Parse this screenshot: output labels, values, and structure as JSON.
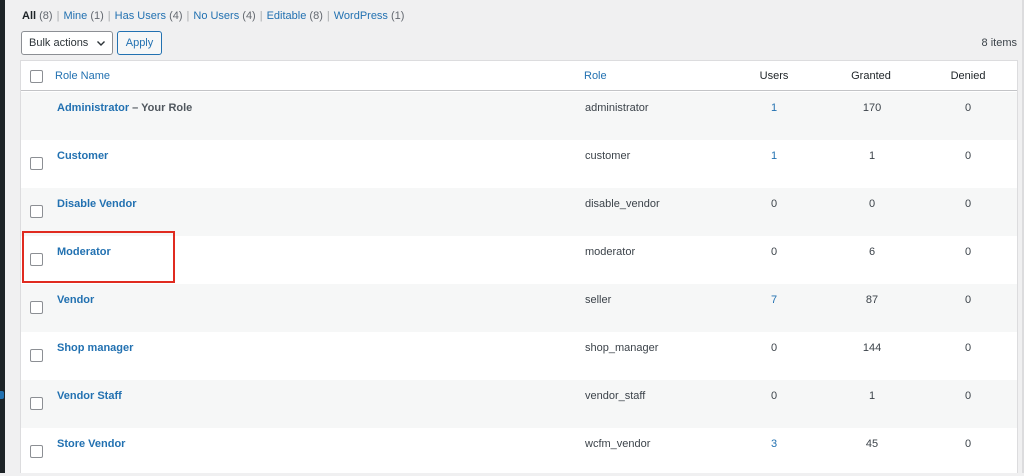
{
  "views": [
    {
      "label": "All",
      "count": "(8)",
      "current": true
    },
    {
      "label": "Mine",
      "count": "(1)",
      "current": false
    },
    {
      "label": "Has Users",
      "count": "(4)",
      "current": false
    },
    {
      "label": "No Users",
      "count": "(4)",
      "current": false
    },
    {
      "label": "Editable",
      "count": "(8)",
      "current": false
    },
    {
      "label": "WordPress",
      "count": "(1)",
      "current": false
    }
  ],
  "view_separator": "|",
  "bulk_actions": {
    "selected": "Bulk actions"
  },
  "apply_label": "Apply",
  "items_count": "8 items",
  "columns": {
    "role_name": "Role Name",
    "role": "Role",
    "users": "Users",
    "granted": "Granted",
    "denied": "Denied"
  },
  "rows": [
    {
      "name": "Administrator",
      "suffix": " – Your Role",
      "slug": "administrator",
      "users": "1",
      "granted": "170",
      "denied": "0",
      "checkbox": false
    },
    {
      "name": "Customer",
      "suffix": "",
      "slug": "customer",
      "users": "1",
      "granted": "1",
      "denied": "0",
      "checkbox": true
    },
    {
      "name": "Disable Vendor",
      "suffix": "",
      "slug": "disable_vendor",
      "users": "0",
      "granted": "0",
      "denied": "0",
      "checkbox": true
    },
    {
      "name": "Moderator",
      "suffix": "",
      "slug": "moderator",
      "users": "0",
      "granted": "6",
      "denied": "0",
      "checkbox": true
    },
    {
      "name": "Vendor",
      "suffix": "",
      "slug": "seller",
      "users": "7",
      "granted": "87",
      "denied": "0",
      "checkbox": true
    },
    {
      "name": "Shop manager",
      "suffix": "",
      "slug": "shop_manager",
      "users": "0",
      "granted": "144",
      "denied": "0",
      "checkbox": true
    },
    {
      "name": "Vendor Staff",
      "suffix": "",
      "slug": "vendor_staff",
      "users": "0",
      "granted": "1",
      "denied": "0",
      "checkbox": true
    },
    {
      "name": "Store Vendor",
      "suffix": "",
      "slug": "wcfm_vendor",
      "users": "3",
      "granted": "45",
      "denied": "0",
      "checkbox": true
    }
  ],
  "colors": {
    "link": "#2271b1",
    "highlight": "#e02b20",
    "alt_row": "#f6f7f7"
  },
  "highlighted_row": "Moderator"
}
